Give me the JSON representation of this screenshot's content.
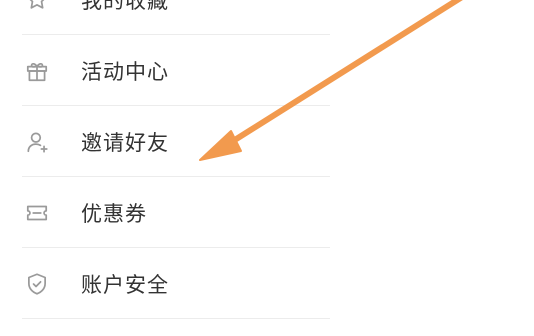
{
  "menu": {
    "items": [
      {
        "label": "我的收藏",
        "icon": "star-icon"
      },
      {
        "label": "活动中心",
        "icon": "gift-icon"
      },
      {
        "label": "邀请好友",
        "icon": "user-add-icon"
      },
      {
        "label": "优惠券",
        "icon": "coupon-icon"
      },
      {
        "label": "账户安全",
        "icon": "shield-icon"
      }
    ]
  },
  "colors": {
    "annotation_arrow": "#f29a4e",
    "label_text": "#333333",
    "icon_stroke": "#9a9a9a",
    "divider": "#ececec"
  }
}
